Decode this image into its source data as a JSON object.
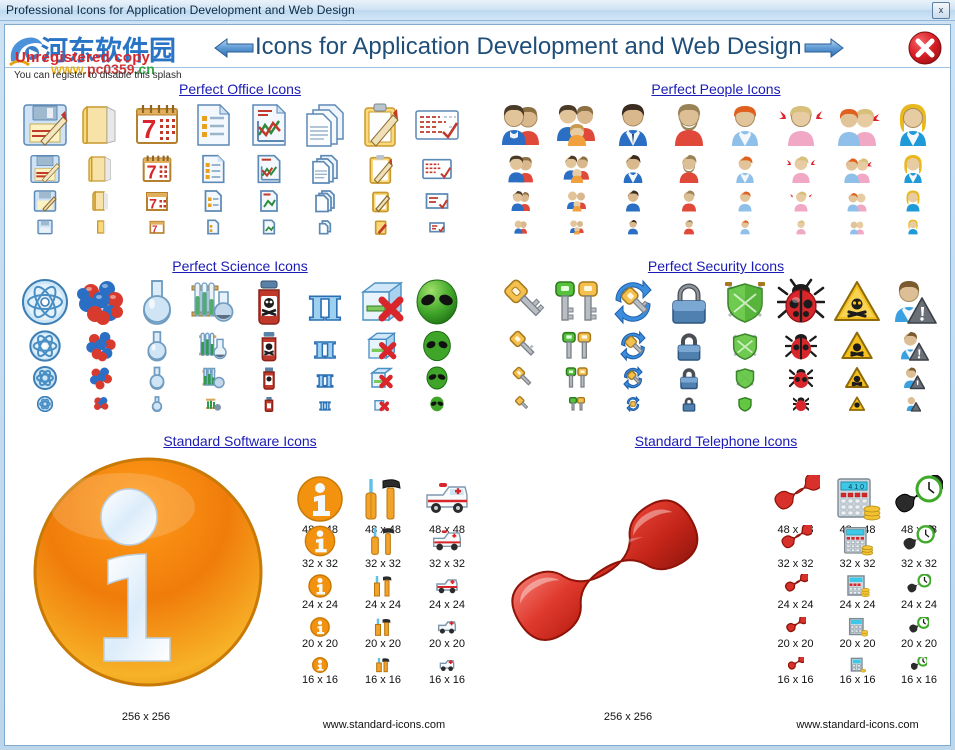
{
  "window": {
    "title": "Professional Icons for Application Development and Web Design",
    "sys_close_label": "x"
  },
  "header": {
    "title": "Icons for Application Development and Web Design",
    "prev_icon": "arrow-left-icon",
    "next_icon": "arrow-right-icon",
    "close_icon": "close-circle-icon"
  },
  "watermark": {
    "unregistered": "Unregistered copy",
    "note": "You can register to disable this splash",
    "site_cn": "河东软件园",
    "site_url_w": "www.",
    "site_url_p": "pc0359",
    "site_url_c": ".cn"
  },
  "sections": [
    {
      "id": "perfect-office-icons",
      "title": "Perfect Office Icons",
      "icons": [
        "floppy-save-icon",
        "folder-icon",
        "calendar-icon",
        "list-document-icon",
        "chart-document-icon",
        "documents-stack-icon",
        "clipboard-pencil-icon",
        "checklist-icon"
      ]
    },
    {
      "id": "perfect-people-icons",
      "title": "Perfect People Icons",
      "icons": [
        "couple-icon",
        "family-icon",
        "man-icon",
        "man-beard-icon",
        "boy-icon",
        "girl-icon",
        "children-icon",
        "woman-icon"
      ]
    },
    {
      "id": "perfect-science-icons",
      "title": "Perfect Science Icons",
      "icons": [
        "atom-icon",
        "molecule-icon",
        "flask-icon",
        "test-tubes-icon",
        "poison-bottle-icon",
        "pi-symbol-icon",
        "delete-box-icon",
        "alien-head-icon"
      ]
    },
    {
      "id": "perfect-security-icons",
      "title": "Perfect Security Icons",
      "icons": [
        "key-icon",
        "two-keys-icon",
        "key-sync-icon",
        "padlock-icon",
        "shield-swords-icon",
        "bug-icon",
        "hazard-triangle-icon",
        "user-warning-icon"
      ]
    }
  ],
  "showcases": [
    {
      "id": "standard-software-icons",
      "title": "Standard Software Icons",
      "hero_icon": "info-ball-icon",
      "hero_caption": "256 x 256",
      "site": "www.standard-icons.com",
      "columns": [
        "info-ball-icon",
        "tools-icon",
        "ambulance-icon"
      ],
      "sizes": [
        "48 x 48",
        "32 x 32",
        "24 x 24",
        "20 x 20",
        "16 x 16"
      ]
    },
    {
      "id": "standard-telephone-icons",
      "title": "Standard Telephone Icons",
      "hero_icon": "phone-handset-icon",
      "hero_caption": "256 x 256",
      "site": "www.standard-icons.com",
      "columns": [
        "phone-handset-icon",
        "calculator-coins-icon",
        "phone-clock-icon"
      ],
      "sizes": [
        "48 x 48",
        "32 x 32",
        "24 x 24",
        "20 x 20",
        "16 x 16"
      ]
    }
  ]
}
